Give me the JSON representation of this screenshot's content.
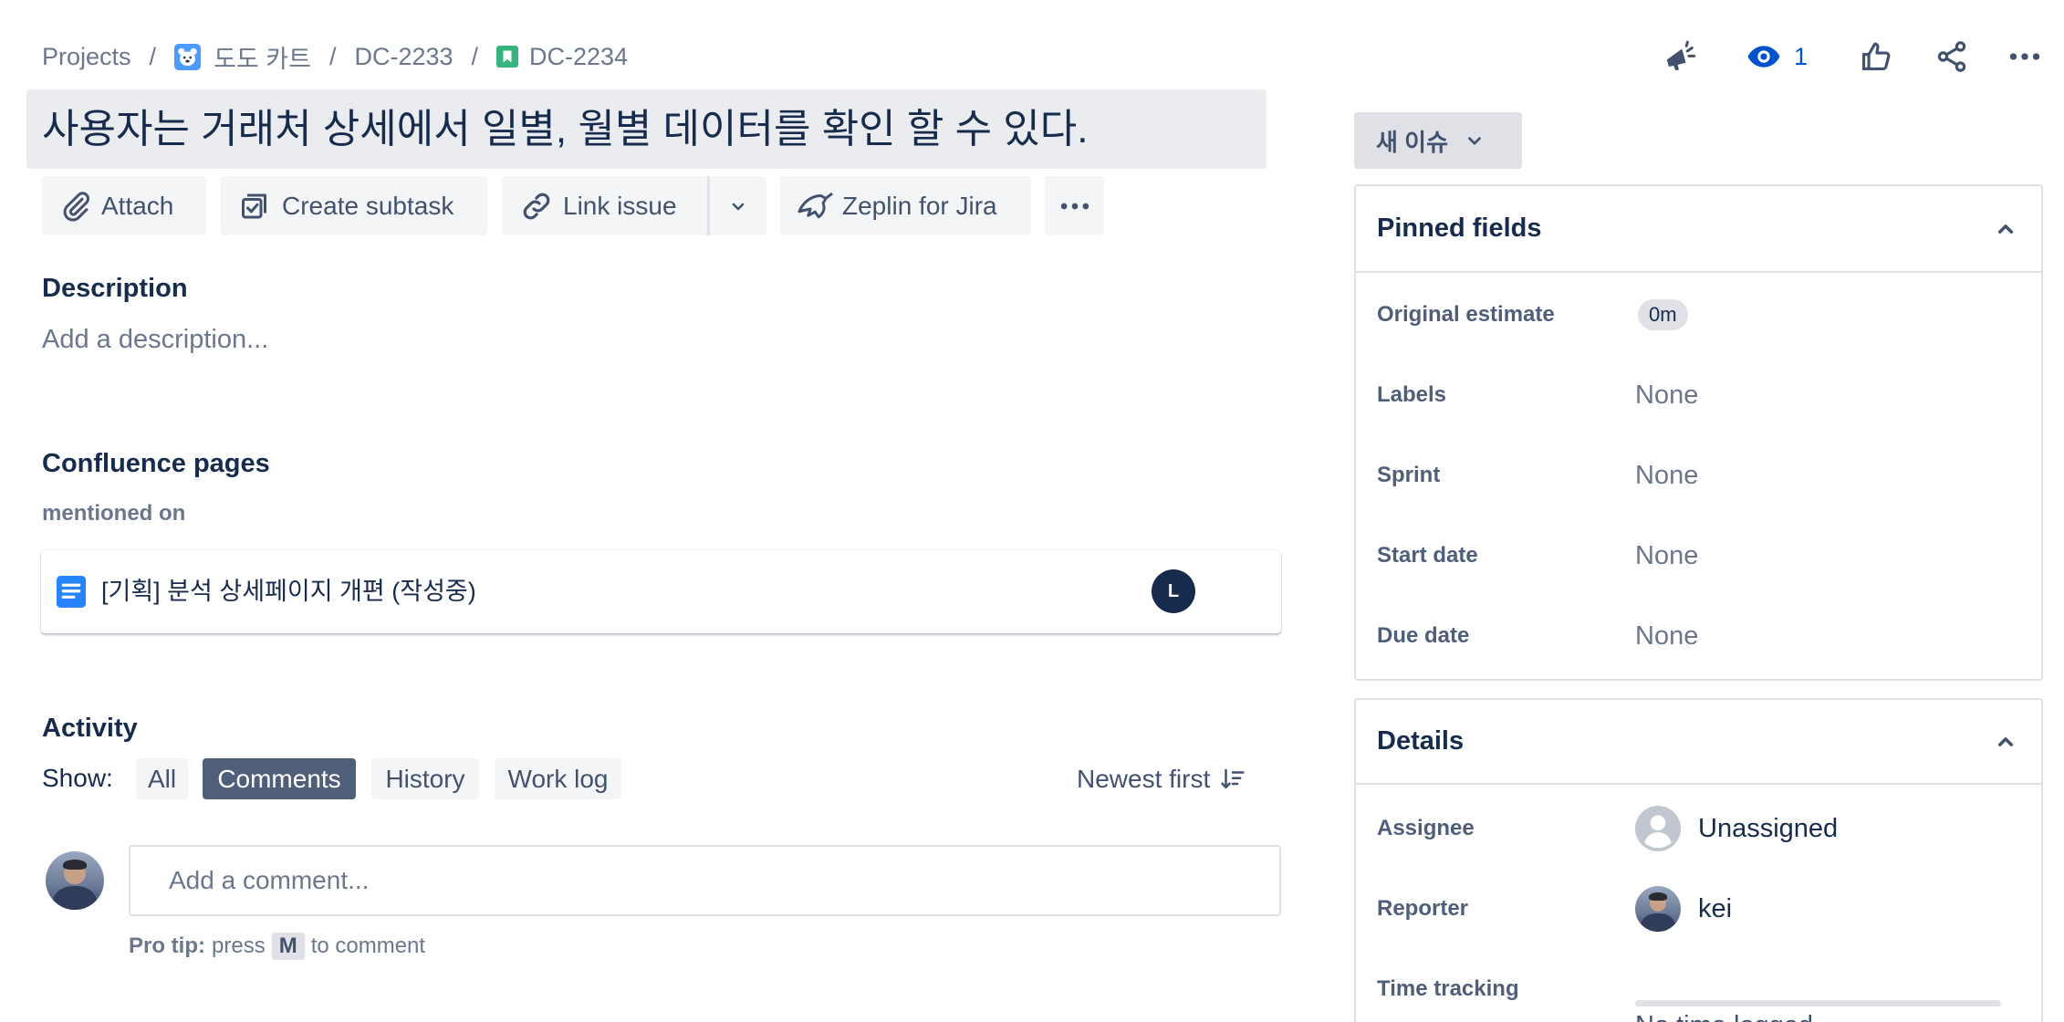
{
  "breadcrumb": {
    "separator": "/",
    "projects": "Projects",
    "project": {
      "label": "도도 카트",
      "icon": "project-avatar-icon"
    },
    "parent": {
      "label": "DC-2233"
    },
    "issue": {
      "label": "DC-2234",
      "icon": "story-icon"
    }
  },
  "header_actions": {
    "feedback_icon": "megaphone-icon",
    "watch_icon": "eye-icon",
    "watch_count": "1",
    "vote_icon": "thumbs-up-icon",
    "share_icon": "share-icon",
    "more_icon": "more-icon"
  },
  "issue": {
    "title": "사용자는 거래처 상세에서 일별, 월별 데이터를 확인 할 수 있다."
  },
  "toolbar": {
    "attach": "Attach",
    "create_subtask": "Create subtask",
    "link_issue": "Link issue",
    "zeplin": "Zeplin for Jira"
  },
  "description": {
    "heading": "Description",
    "placeholder": "Add a description..."
  },
  "confluence": {
    "heading": "Confluence pages",
    "subheading": "mentioned on",
    "pages": [
      {
        "title": "[기획] 분석 상세페이지 개편 (작성중)",
        "author_initial": "L",
        "icon": "confluence-page-icon"
      }
    ]
  },
  "activity": {
    "heading": "Activity",
    "show_label": "Show:",
    "filters": [
      {
        "label": "All",
        "selected": false
      },
      {
        "label": "Comments",
        "selected": true
      },
      {
        "label": "History",
        "selected": false
      },
      {
        "label": "Work log",
        "selected": false
      }
    ],
    "sort_label": "Newest first",
    "comment_placeholder": "Add a comment...",
    "pro_tip": {
      "prefix": "Pro tip:",
      "press": "press",
      "key": "M",
      "suffix": "to comment"
    }
  },
  "status": {
    "label": "새 이슈"
  },
  "pinned_fields": {
    "heading": "Pinned fields",
    "fields": [
      {
        "label": "Original estimate",
        "value": "0m"
      },
      {
        "label": "Labels",
        "value": "None"
      },
      {
        "label": "Sprint",
        "value": "None"
      },
      {
        "label": "Start date",
        "value": "None"
      },
      {
        "label": "Due date",
        "value": "None"
      }
    ]
  },
  "details": {
    "heading": "Details",
    "assignee": {
      "label": "Assignee",
      "value": "Unassigned"
    },
    "reporter": {
      "label": "Reporter",
      "value": "kei"
    },
    "time_tracking": {
      "label": "Time tracking",
      "value": "No time logged",
      "logged_fraction": 0
    }
  },
  "colors": {
    "text": "#172b4d",
    "subtle": "#6b778c",
    "selected_filter": "#505f79",
    "watch": "#0052cc",
    "story": "#36b37e",
    "project": "#4c9aff",
    "page": "#2684ff"
  }
}
